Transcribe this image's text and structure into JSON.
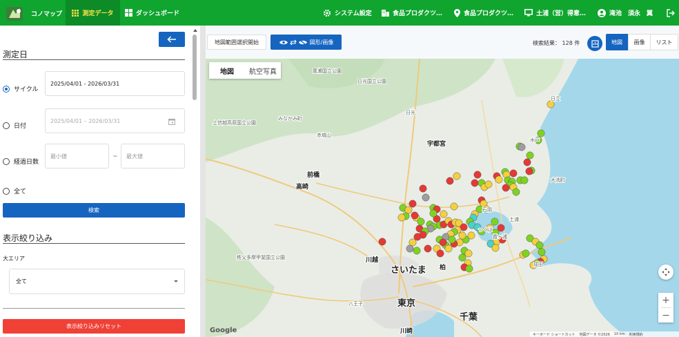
{
  "header": {
    "app_name": "コノマップ",
    "nav_measurement": "測定データ",
    "nav_dashboard": "ダッシュボード",
    "nav_system": "システム設定",
    "nav_product1": "食品プロダクツ…",
    "nav_product2": "食品プロダクツ…",
    "nav_site": "土浦（営）得意…",
    "user_name": "滝池　須永　翼"
  },
  "sidebar": {
    "measure_date_title": "測定日",
    "radio_cycle": "サイクル",
    "cycle_value": "2025/04/01 - 2026/03/31",
    "radio_date": "日付",
    "date_value": "2025/04/01 – 2026/03/31",
    "radio_elapsed": "経過日数",
    "min_placeholder": "最小値",
    "range_sep": "~",
    "max_placeholder": "最大値",
    "radio_all": "全て",
    "search_button": "検索",
    "filter_title": "表示絞り込み",
    "area_label": "大エリア",
    "area_value": "全て",
    "reset_button": "表示絞り込みリセット"
  },
  "toolbar": {
    "range_select": "地図範囲選択開始",
    "toggle_label": "図形/画像",
    "result_text": "検索結果： 128 件",
    "view_map": "地図",
    "view_image": "画像",
    "view_list": "リスト"
  },
  "map": {
    "type_map": "地図",
    "type_satellite": "航空写真",
    "google_logo": "Google",
    "footer_shortcuts": "キーボード ショートカット",
    "footer_data": "地図データ ©2026",
    "footer_scale": "10 km",
    "footer_terms": "利用規約",
    "zoom_in": "+",
    "zoom_out": "−",
    "labels": [
      {
        "text": "さいたま",
        "cls": "big"
      },
      {
        "text": "東京",
        "cls": "big"
      },
      {
        "text": "千葉",
        "cls": "big"
      },
      {
        "text": "前橋",
        "cls": "mid"
      },
      {
        "text": "高崎",
        "cls": "mid"
      },
      {
        "text": "宇都宮",
        "cls": "mid"
      },
      {
        "text": "川越",
        "cls": "mid"
      },
      {
        "text": "柏",
        "cls": "mid"
      },
      {
        "text": "川崎",
        "cls": "mid"
      },
      {
        "text": "八王子",
        "cls": "small"
      },
      {
        "text": "日光",
        "cls": "small"
      },
      {
        "text": "石岡",
        "cls": "small"
      },
      {
        "text": "霞ヶ浦",
        "cls": "small"
      },
      {
        "text": "赤城山",
        "cls": "small"
      },
      {
        "text": "日光国立公園",
        "cls": "small"
      },
      {
        "text": "尾瀬国立公園",
        "cls": "small"
      },
      {
        "text": "上信越高原国立公園",
        "cls": "small"
      },
      {
        "text": "秩父多摩甲斐国立公園",
        "cls": "small"
      },
      {
        "text": "みなかみ町",
        "cls": "small"
      },
      {
        "text": "大洗町",
        "cls": "small"
      },
      {
        "text": "日立",
        "cls": "small"
      },
      {
        "text": "水戸",
        "cls": "small"
      },
      {
        "text": "土浦",
        "cls": "small"
      },
      {
        "text": "つくば",
        "cls": "small"
      },
      {
        "text": "成田",
        "cls": "small"
      }
    ]
  },
  "colors": {
    "header_green": "#0fa52f",
    "primary_blue": "#1565c0",
    "reset_red": "#ef4136",
    "marker_red": "#e53935",
    "marker_yellow": "#f4d03f",
    "marker_green": "#7ed321",
    "marker_gray": "#9e9e9e",
    "marker_cyan": "#4dd0c8"
  }
}
